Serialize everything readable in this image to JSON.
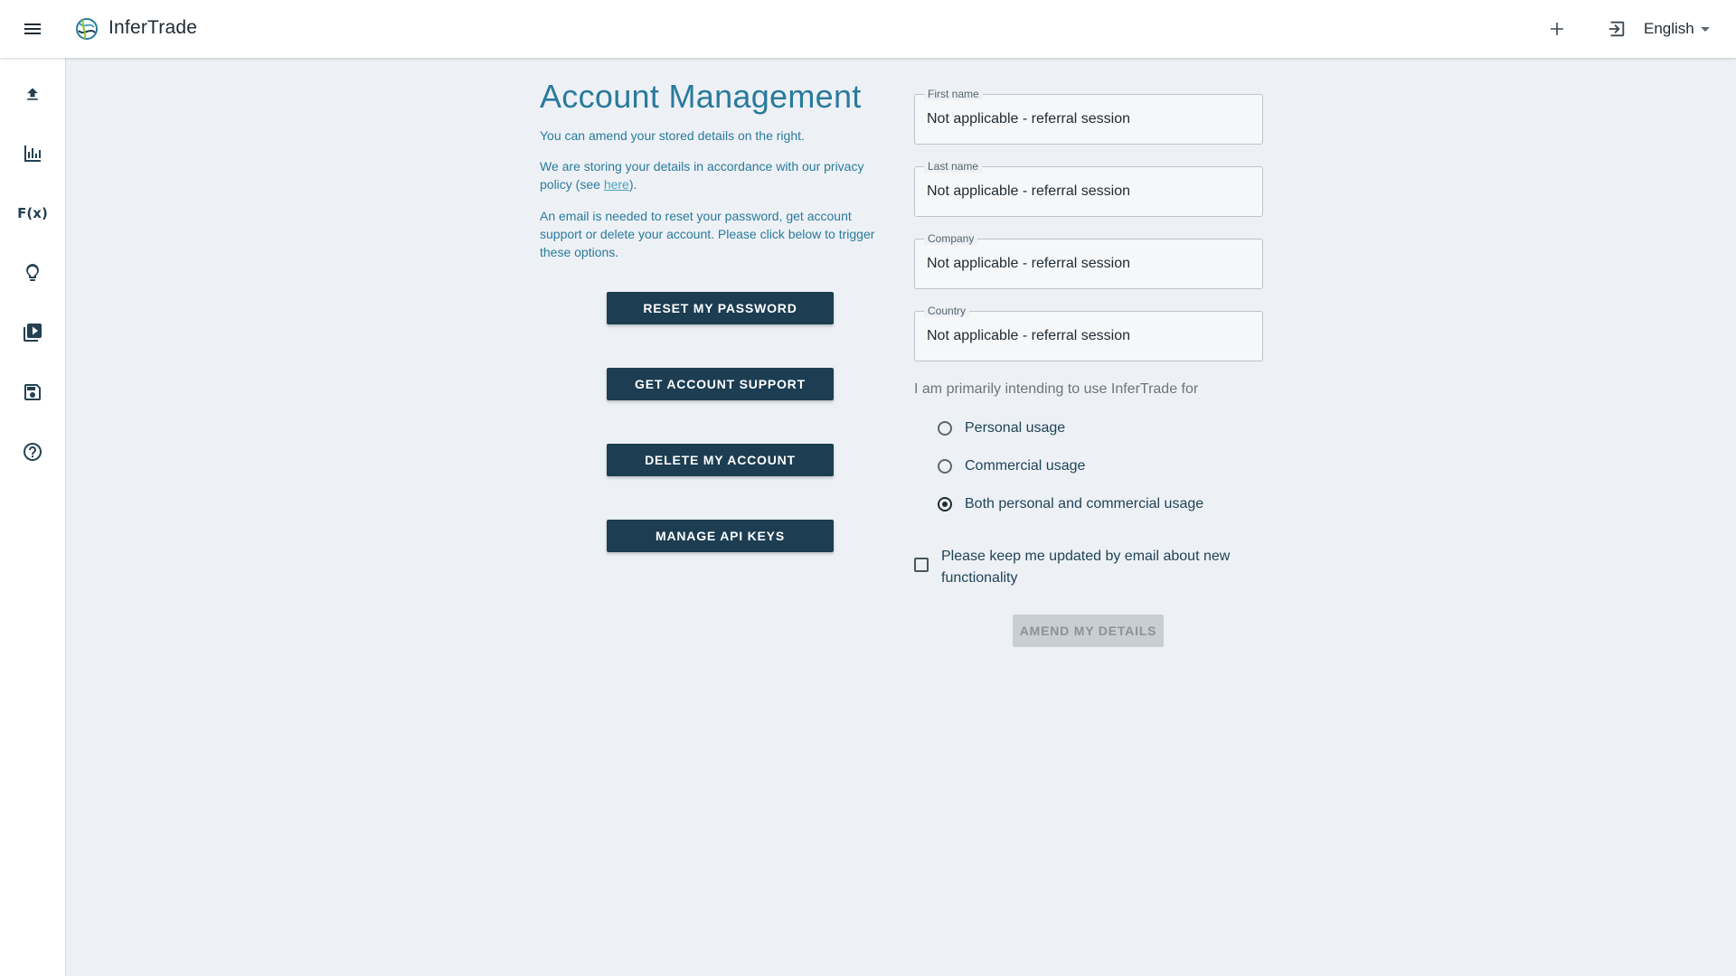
{
  "header": {
    "app_name": "InferTrade",
    "language": "English",
    "menu_icon": "menu-icon",
    "add_icon": "plus-icon",
    "login_icon": "login-icon"
  },
  "sidebar": {
    "items": [
      {
        "name": "upload",
        "icon": "upload-icon"
      },
      {
        "name": "charts",
        "icon": "bar-chart-icon"
      },
      {
        "name": "functions",
        "icon": "function-icon",
        "label": "F(x)"
      },
      {
        "name": "ideas",
        "icon": "lightbulb-icon"
      },
      {
        "name": "videos",
        "icon": "video-library-icon"
      },
      {
        "name": "save",
        "icon": "save-icon"
      },
      {
        "name": "help",
        "icon": "help-icon"
      }
    ]
  },
  "account": {
    "title": "Account Management",
    "intro": "You can amend your stored details on the right.",
    "privacy_before": "We are storing your details in accordance with our privacy policy (see ",
    "privacy_link": "here",
    "privacy_after": ").",
    "email_note": "An email is needed to reset your password, get account support or delete your account. Please click below to trigger these options.",
    "buttons": {
      "reset_password": "RESET MY PASSWORD",
      "account_support": "GET ACCOUNT SUPPORT",
      "delete_account": "DELETE MY ACCOUNT",
      "manage_api": "MANAGE API KEYS"
    }
  },
  "form": {
    "first_name": {
      "label": "First name",
      "value": "Not applicable - referral session"
    },
    "last_name": {
      "label": "Last name",
      "value": "Not applicable - referral session"
    },
    "company": {
      "label": "Company",
      "value": "Not applicable - referral session"
    },
    "country": {
      "label": "Country",
      "value": "Not applicable - referral session"
    },
    "usage_question": "I am primarily intending to use InferTrade for",
    "usage_options": [
      {
        "label": "Personal usage",
        "selected": false
      },
      {
        "label": "Commercial usage",
        "selected": false
      },
      {
        "label": "Both personal and commercial usage",
        "selected": true
      }
    ],
    "newsletter_label": "Please keep me updated by email about new functionality",
    "newsletter_checked": false,
    "submit_label": "AMEND MY DETAILS"
  },
  "colors": {
    "accent": "#2a7a9c",
    "primary_button": "#1c3d52",
    "background": "#edf1f5",
    "disabled_button": "#c9ced2"
  }
}
